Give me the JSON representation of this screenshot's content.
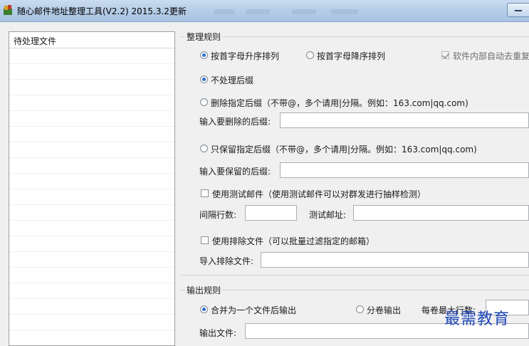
{
  "window": {
    "title": "随心邮件地址整理工具(V2.2)  2015.3.2更新"
  },
  "file_list": {
    "header": "待处理文件"
  },
  "rules": {
    "group_title": "整理规则",
    "sort_asc_label": "按首字母升序排列",
    "sort_desc_label": "按首字母降序排列",
    "dedupe_label": "软件内部自动去重复",
    "no_suffix_label": "不处理后缀",
    "delete_suffix_label": "删除指定后缀（不带@，多个请用|分隔。例如：163.com|qq.com)",
    "delete_suffix_input_label": "输入要删除的后缀:",
    "delete_suffix_value": "",
    "keep_suffix_label": "只保留指定后缀（不带@，多个请用|分隔。例如：163.com|qq.com)",
    "keep_suffix_input_label": "输入要保留的后缀:",
    "keep_suffix_value": "",
    "test_mail_label": "使用测试邮件（使用测试邮件可以对群发进行抽样检测）",
    "interval_label": "间隔行数:",
    "interval_value": "",
    "test_address_label": "测试邮址:",
    "test_address_value": "",
    "exclude_file_label": "使用排除文件（可以批量过滤指定的邮箱）",
    "import_exclude_label": "导入排除文件:",
    "import_exclude_value": ""
  },
  "output": {
    "group_title": "输出规则",
    "merge_label": "合并为一个文件后输出",
    "split_label": "分卷输出",
    "max_lines_label": "每卷最大行数:",
    "output_file_label": "输出文件:",
    "output_file_value": ""
  },
  "watermark": {
    "text": "最需教育"
  },
  "state": {
    "sort_order": "asc",
    "dedupe_checked": true,
    "suffix_mode": "none",
    "test_mail_checked": false,
    "exclude_file_checked": false,
    "output_mode": "merge"
  }
}
